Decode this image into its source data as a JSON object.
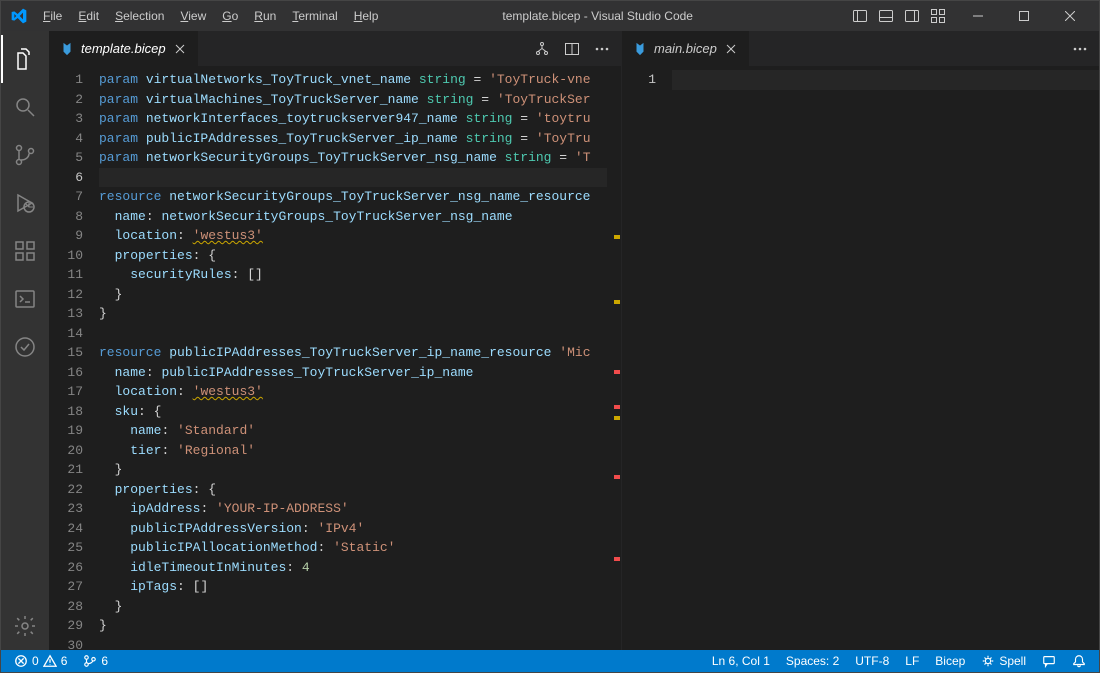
{
  "window": {
    "title": "template.bicep - Visual Studio Code"
  },
  "menu": {
    "file": "File",
    "edit": "Edit",
    "selection": "Selection",
    "view": "View",
    "go": "Go",
    "run": "Run",
    "terminal": "Terminal",
    "help": "Help"
  },
  "tabs": {
    "left": {
      "label": "template.bicep"
    },
    "right": {
      "label": "main.bicep"
    }
  },
  "editor_left": {
    "line_count": 30,
    "current_line": 6,
    "lines": [
      [
        [
          "kw",
          "param "
        ],
        [
          "ident",
          "virtualNetworks_ToyTruck_vnet_name "
        ],
        [
          "type",
          "string"
        ],
        [
          "op",
          " = "
        ],
        [
          "str",
          "'ToyTruck-vne"
        ]
      ],
      [
        [
          "kw",
          "param "
        ],
        [
          "ident",
          "virtualMachines_ToyTruckServer_name "
        ],
        [
          "type",
          "string"
        ],
        [
          "op",
          " = "
        ],
        [
          "str",
          "'ToyTruckSer"
        ]
      ],
      [
        [
          "kw",
          "param "
        ],
        [
          "ident",
          "networkInterfaces_toytruckserver947_name "
        ],
        [
          "type",
          "string"
        ],
        [
          "op",
          " = "
        ],
        [
          "str",
          "'toytru"
        ]
      ],
      [
        [
          "kw",
          "param "
        ],
        [
          "ident",
          "publicIPAddresses_ToyTruckServer_ip_name "
        ],
        [
          "type",
          "string"
        ],
        [
          "op",
          " = "
        ],
        [
          "str",
          "'ToyTru"
        ]
      ],
      [
        [
          "kw",
          "param "
        ],
        [
          "ident",
          "networkSecurityGroups_ToyTruckServer_nsg_name "
        ],
        [
          "type",
          "string"
        ],
        [
          "op",
          " = "
        ],
        [
          "str",
          "'T"
        ]
      ],
      [],
      [
        [
          "kw",
          "resource "
        ],
        [
          "ident",
          "networkSecurityGroups_ToyTruckServer_nsg_name_resource"
        ]
      ],
      [
        [
          "op",
          "  "
        ],
        [
          "prop",
          "name"
        ],
        [
          "op",
          ": "
        ],
        [
          "ident",
          "networkSecurityGroups_ToyTruckServer_nsg_name"
        ]
      ],
      [
        [
          "op",
          "  "
        ],
        [
          "prop",
          "location"
        ],
        [
          "op",
          ": "
        ],
        [
          "str_u",
          "'westus3'"
        ]
      ],
      [
        [
          "op",
          "  "
        ],
        [
          "prop",
          "properties"
        ],
        [
          "op",
          ": "
        ],
        [
          "brace",
          "{"
        ]
      ],
      [
        [
          "op",
          "    "
        ],
        [
          "prop",
          "securityRules"
        ],
        [
          "op",
          ": "
        ],
        [
          "brace",
          "[]"
        ]
      ],
      [
        [
          "op",
          "  "
        ],
        [
          "brace",
          "}"
        ]
      ],
      [
        [
          "brace",
          "}"
        ]
      ],
      [],
      [
        [
          "kw",
          "resource "
        ],
        [
          "ident",
          "publicIPAddresses_ToyTruckServer_ip_name_resource "
        ],
        [
          "str",
          "'Mic"
        ]
      ],
      [
        [
          "op",
          "  "
        ],
        [
          "prop",
          "name"
        ],
        [
          "op",
          ": "
        ],
        [
          "ident",
          "publicIPAddresses_ToyTruckServer_ip_name"
        ]
      ],
      [
        [
          "op",
          "  "
        ],
        [
          "prop",
          "location"
        ],
        [
          "op",
          ": "
        ],
        [
          "str_u",
          "'westus3'"
        ]
      ],
      [
        [
          "op",
          "  "
        ],
        [
          "prop",
          "sku"
        ],
        [
          "op",
          ": "
        ],
        [
          "brace",
          "{"
        ]
      ],
      [
        [
          "op",
          "    "
        ],
        [
          "prop",
          "name"
        ],
        [
          "op",
          ": "
        ],
        [
          "str",
          "'Standard'"
        ]
      ],
      [
        [
          "op",
          "    "
        ],
        [
          "prop",
          "tier"
        ],
        [
          "op",
          ": "
        ],
        [
          "str",
          "'Regional'"
        ]
      ],
      [
        [
          "op",
          "  "
        ],
        [
          "brace",
          "}"
        ]
      ],
      [
        [
          "op",
          "  "
        ],
        [
          "prop",
          "properties"
        ],
        [
          "op",
          ": "
        ],
        [
          "brace",
          "{"
        ]
      ],
      [
        [
          "op",
          "    "
        ],
        [
          "prop",
          "ipAddress"
        ],
        [
          "op",
          ": "
        ],
        [
          "str",
          "'YOUR-IP-ADDRESS'"
        ]
      ],
      [
        [
          "op",
          "    "
        ],
        [
          "prop",
          "publicIPAddressVersion"
        ],
        [
          "op",
          ": "
        ],
        [
          "str",
          "'IPv4'"
        ]
      ],
      [
        [
          "op",
          "    "
        ],
        [
          "prop",
          "publicIPAllocationMethod"
        ],
        [
          "op",
          ": "
        ],
        [
          "str",
          "'Static'"
        ]
      ],
      [
        [
          "op",
          "    "
        ],
        [
          "prop",
          "idleTimeoutInMinutes"
        ],
        [
          "op",
          ": "
        ],
        [
          "num",
          "4"
        ]
      ],
      [
        [
          "op",
          "    "
        ],
        [
          "prop",
          "ipTags"
        ],
        [
          "op",
          ": "
        ],
        [
          "brace",
          "[]"
        ]
      ],
      [
        [
          "op",
          "  "
        ],
        [
          "brace",
          "}"
        ]
      ],
      [
        [
          "brace",
          "}"
        ]
      ],
      []
    ]
  },
  "editor_right": {
    "line_count": 1,
    "current_line": 1,
    "lines": [
      []
    ]
  },
  "status": {
    "errors": "0",
    "warnings": "6",
    "scm": "6",
    "lncol": "Ln 6, Col 1",
    "spaces": "Spaces: 2",
    "encoding": "UTF-8",
    "eol": "LF",
    "lang": "Bicep",
    "spell": "Spell"
  },
  "markers": [
    {
      "pos": 29,
      "cls": "y"
    },
    {
      "pos": 40,
      "cls": "y"
    },
    {
      "pos": 52,
      "cls": "r"
    },
    {
      "pos": 58,
      "cls": "r"
    },
    {
      "pos": 60,
      "cls": "y"
    },
    {
      "pos": 70,
      "cls": "r"
    },
    {
      "pos": 84,
      "cls": "r"
    }
  ]
}
